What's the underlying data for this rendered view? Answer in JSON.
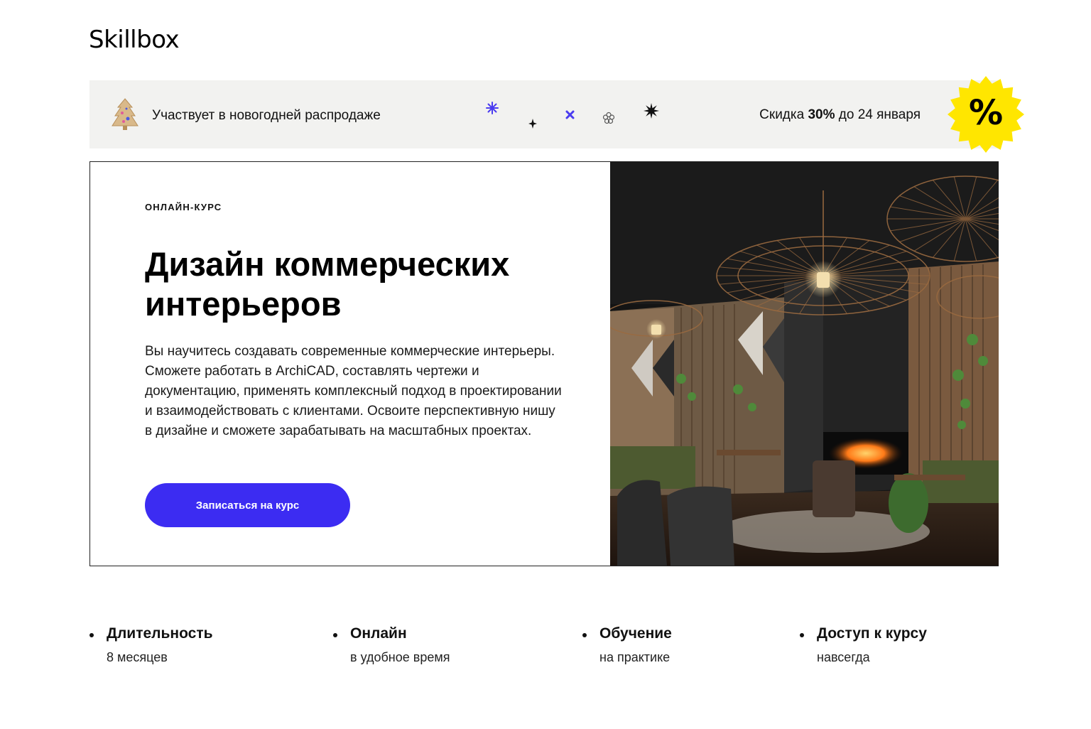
{
  "header": {
    "logo": "Skillbox"
  },
  "promo": {
    "text": "Участвует в новогодней распродаже",
    "discount_prefix": "Скидка ",
    "discount_value": "30%",
    "discount_suffix": " до 24 января",
    "badge": "%",
    "badge_color": "#ffe600",
    "decor_icons": [
      "asterisk-icon",
      "sparkle-icon",
      "cross-icon",
      "flower-icon",
      "star-burst-icon"
    ]
  },
  "hero": {
    "tag": "ОНЛАЙН-КУРС",
    "title": "Дизайн коммерческих интерьеров",
    "description": "Вы научитесь создавать современные коммерческие интерьеры. Сможете работать в ArchiCAD, составлять чертежи и документацию, применять комплексный подход в проектировании и взаимодействовать с клиентами. Освоите перспективную нишу в дизайне и сможете зарабатывать на масштабных проектах.",
    "cta_label": "Записаться на курс",
    "accent_color": "#3c2cf2"
  },
  "features": [
    {
      "title": "Длительность",
      "subtitle": "8 месяцев"
    },
    {
      "title": "Онлайн",
      "subtitle": "в удобное время"
    },
    {
      "title": "Обучение",
      "subtitle": "на практике"
    },
    {
      "title": "Доступ к курсу",
      "subtitle": "навсегда"
    }
  ]
}
